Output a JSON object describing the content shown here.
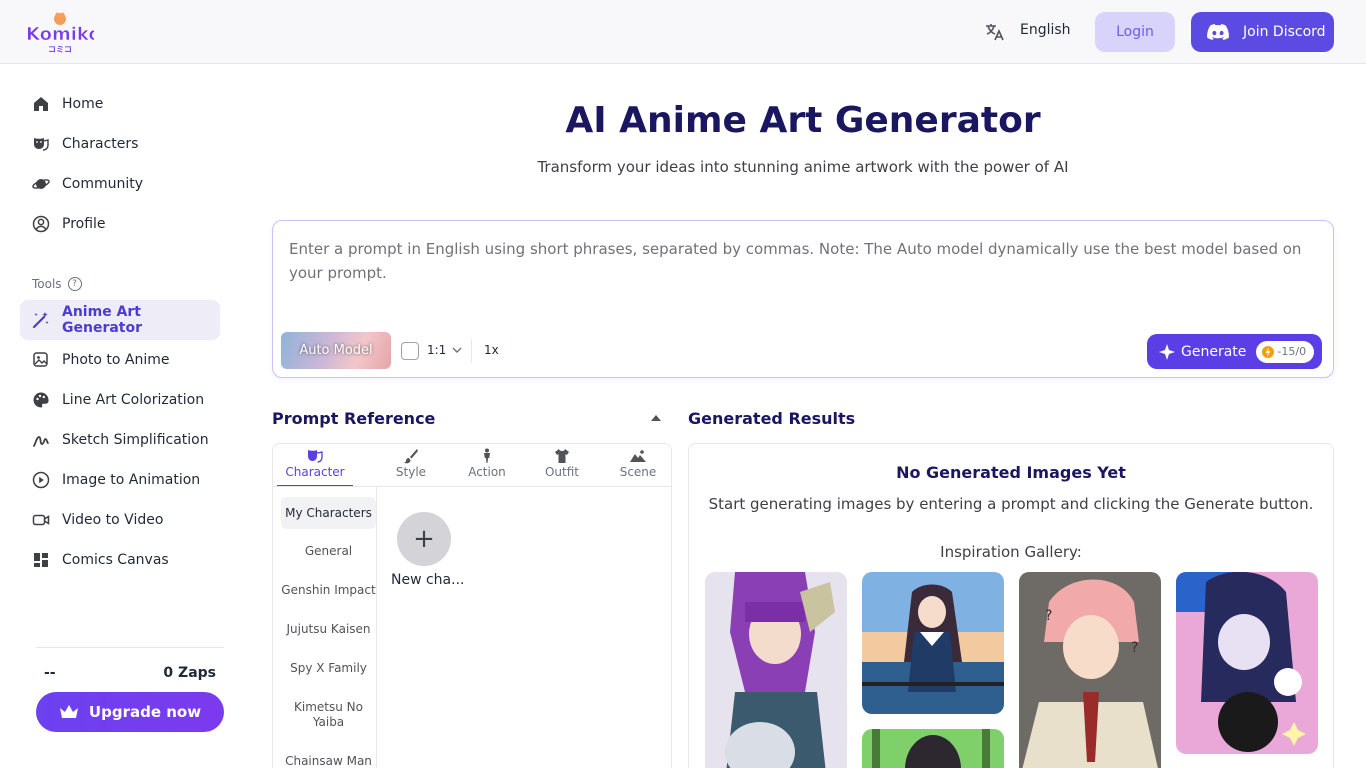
{
  "header": {
    "logo_text": "Komiko",
    "logo_subtext": "コミコ",
    "language": "English",
    "login_label": "Login",
    "discord_label": "Join Discord"
  },
  "sidebar": {
    "nav": [
      {
        "label": "Home",
        "icon": "home-icon"
      },
      {
        "label": "Characters",
        "icon": "characters-icon"
      },
      {
        "label": "Community",
        "icon": "community-icon"
      },
      {
        "label": "Profile",
        "icon": "profile-icon"
      }
    ],
    "tools_label": "Tools",
    "tools_help": "?",
    "tools": [
      {
        "label": "Anime Art Generator",
        "icon": "magic-wand-icon",
        "active": true
      },
      {
        "label": "Photo to Anime",
        "icon": "photo-icon"
      },
      {
        "label": "Line Art Colorization",
        "icon": "palette-icon"
      },
      {
        "label": "Sketch Simplification",
        "icon": "sketch-icon"
      },
      {
        "label": "Image to Animation",
        "icon": "play-icon"
      },
      {
        "label": "Video to Video",
        "icon": "video-icon"
      },
      {
        "label": "Comics Canvas",
        "icon": "grid-icon"
      }
    ],
    "account_name": "--",
    "zaps": "0 Zaps",
    "upgrade_label": "Upgrade now"
  },
  "main": {
    "title": "AI Anime Art Generator",
    "subtitle": "Transform your ideas into stunning anime artwork with the power of AI",
    "prompt": {
      "placeholder": "Enter a prompt in English using short phrases, separated by commas. Note: The Auto model dynamically use the best model based on your prompt.",
      "model_label": "Auto Model",
      "ratio": "1:1",
      "multiplier": "1x",
      "generate_label": "Generate",
      "cost": "-15/0"
    },
    "reference": {
      "title": "Prompt Reference",
      "tabs": [
        {
          "label": "Character",
          "icon": "mask-icon",
          "active": true
        },
        {
          "label": "Style",
          "icon": "brush-icon"
        },
        {
          "label": "Action",
          "icon": "person-icon"
        },
        {
          "label": "Outfit",
          "icon": "shirt-icon"
        },
        {
          "label": "Scene",
          "icon": "mountain-icon"
        }
      ],
      "categories": [
        "My Characters",
        "General",
        "Genshin Impact",
        "Jujutsu Kaisen",
        "Spy X Family",
        "Kimetsu No Yaiba",
        "Chainsaw Man"
      ],
      "new_character_label": "New cha..."
    },
    "results": {
      "title": "Generated Results",
      "empty_title": "No Generated Images Yet",
      "empty_desc": "Start generating images by entering a prompt and clicking the Generate button.",
      "inspiration_label": "Inspiration Gallery:"
    }
  },
  "colors": {
    "accent": "#5b3ee6",
    "title": "#1a1660",
    "login_bg": "#d8d3fb"
  }
}
